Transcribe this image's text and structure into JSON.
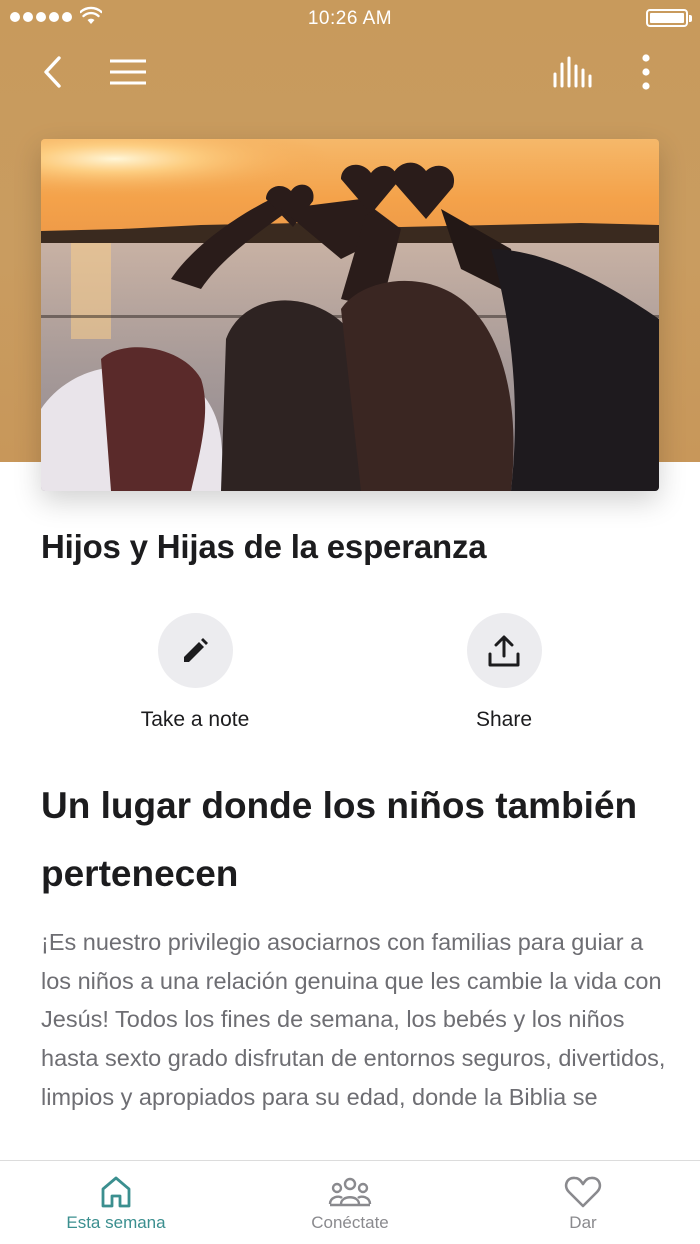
{
  "status_bar": {
    "time": "10:26 AM"
  },
  "nav": {
    "back_icon": "chevron-left-icon",
    "menu_icon": "hamburger-menu-icon",
    "audio_icon": "audio-bars-icon",
    "more_icon": "vertical-dots-icon"
  },
  "hero": {
    "image_icon": "hero-photo"
  },
  "page_title": "Hijos y Hijas de la esperanza",
  "actions": [
    {
      "label": "Take a note",
      "icon": "pencil-icon"
    },
    {
      "label": "Share",
      "icon": "share-upload-icon"
    }
  ],
  "content": {
    "heading": "Un lugar donde los niños también pertenecen",
    "body": "¡Es nuestro privilegio asociarnos con familias para guiar a los niños a una relación genuina que les cambie la vida con Jesús! Todos los fines de semana, los bebés y los niños hasta sexto grado disfrutan de entornos seguros, divertidos, limpios y apropiados para su edad, donde la Biblia se"
  },
  "tabbar": {
    "tabs": [
      {
        "label": "Esta semana",
        "icon": "home-icon",
        "active": true
      },
      {
        "label": "Conéctate",
        "icon": "people-group-icon",
        "active": false
      },
      {
        "label": "Dar",
        "icon": "heart-icon",
        "active": false
      }
    ]
  },
  "colors": {
    "header_bg": "#c89a5c",
    "accent": "#3b8f8f",
    "inactive": "#8a8a8e",
    "action_circle": "#ececef"
  }
}
